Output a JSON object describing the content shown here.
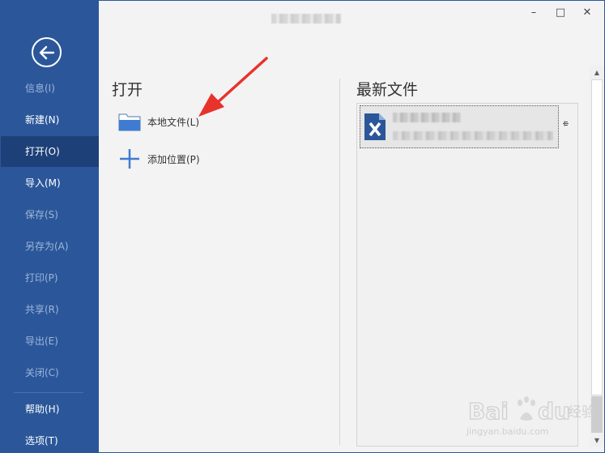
{
  "window": {
    "title": "",
    "controls": {
      "minimize": "–",
      "maximize": "□",
      "close": "✕"
    }
  },
  "sidebar": {
    "back_icon": "arrow-left-circle-icon",
    "items": [
      {
        "label": "信息(I)",
        "state": "disabled"
      },
      {
        "label": "新建(N)",
        "state": "normal"
      },
      {
        "label": "打开(O)",
        "state": "active"
      },
      {
        "label": "导入(M)",
        "state": "normal"
      },
      {
        "label": "保存(S)",
        "state": "disabled"
      },
      {
        "label": "另存为(A)",
        "state": "disabled"
      },
      {
        "label": "打印(P)",
        "state": "disabled"
      },
      {
        "label": "共享(R)",
        "state": "disabled"
      },
      {
        "label": "导出(E)",
        "state": "disabled"
      },
      {
        "label": "关闭(C)",
        "state": "disabled"
      },
      {
        "label": "帮助(H)",
        "state": "normal"
      },
      {
        "label": "选项(T)",
        "state": "normal"
      }
    ]
  },
  "open_section": {
    "title": "打开",
    "locations": [
      {
        "label": "本地文件(L)",
        "icon": "folder-icon"
      },
      {
        "label": "添加位置(P)",
        "icon": "plus-icon"
      }
    ]
  },
  "recent_section": {
    "title": "最新文件",
    "files": [
      {
        "name": "",
        "path": "",
        "icon": "xmind-file-icon"
      }
    ],
    "pin_icon": "pin-icon"
  },
  "scrollbar": {
    "up_icon": "▲",
    "down_icon": "▼"
  },
  "watermark": {
    "brand": "Bai du 经验",
    "url": "jingyan.baidu.com"
  },
  "colors": {
    "sidebar": "#2b579a",
    "sidebar_active": "#1e4078",
    "annotation_arrow": "#e8322c",
    "file_icon": "#2b579a"
  }
}
